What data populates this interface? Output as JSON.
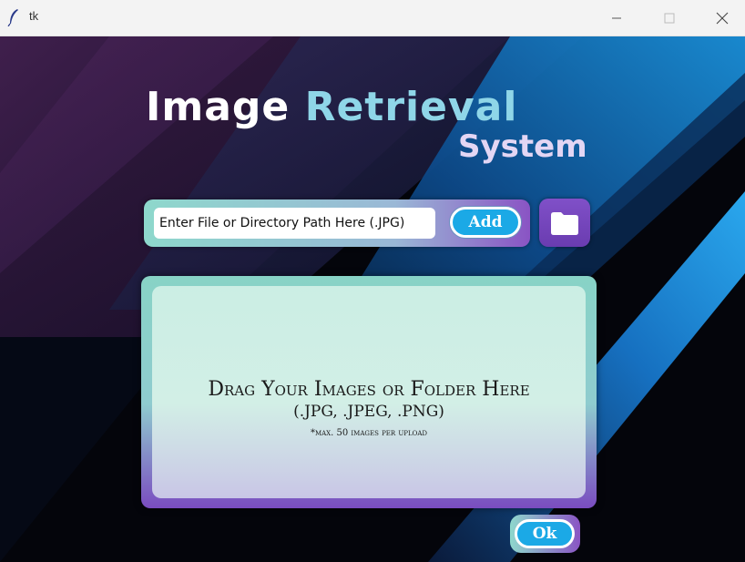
{
  "window": {
    "title": "tk",
    "controls": {
      "minimize": "minimize-icon",
      "maximize": "maximize-icon",
      "close": "close-icon"
    }
  },
  "header": {
    "title_part1": "Image",
    "title_part2": "Retrieval",
    "title_line2": "System"
  },
  "path_bar": {
    "input_value": "Enter File or Directory Path Here (.JPG)",
    "add_label": "Add",
    "folder_icon": "folder-icon"
  },
  "drop_zone": {
    "title": "Drag Your Images or Folder Here",
    "formats": "(.JPG, .JPEG, .PNG)",
    "note": "*max. 50 images per upload"
  },
  "footer": {
    "ok_label": "Ok"
  },
  "colors": {
    "accent_blue": "#1ba9e6",
    "teal": "#8ed8cc",
    "purple": "#7a4cc0",
    "title_blue": "#8fd6e8",
    "title_lavender": "#e3d6f4"
  }
}
